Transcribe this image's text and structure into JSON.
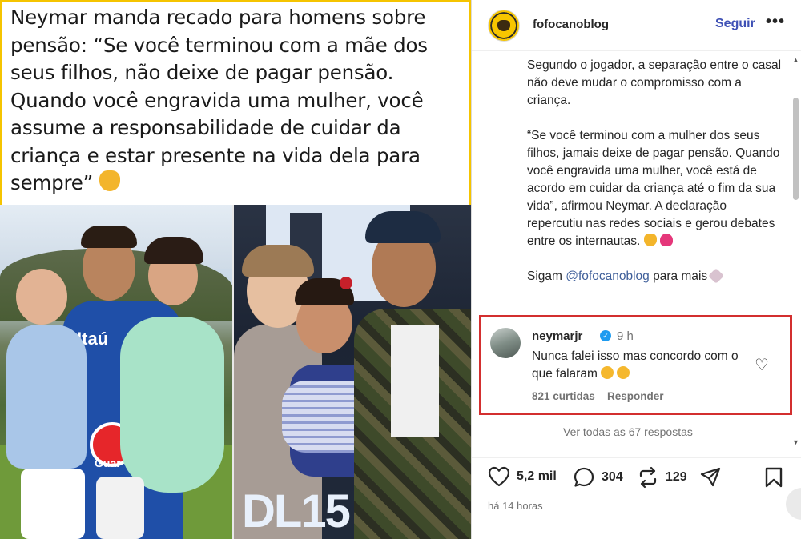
{
  "post": {
    "tweet_text": "Neymar manda recado para homens sobre\npensão: “Se você terminou com a mãe dos\nseus filhos, não deixe de pagar pensão.\nQuando você engravida uma mulher, você\nassume a responsabilidade de cuidar da\ncriança e estar presente na vida dela para\nsempre”",
    "photo_left_text": "Itaú",
    "photo_right_text": "DL15",
    "border_color": "#f5c400"
  },
  "header": {
    "username": "fofocanoblog",
    "follow_label": "Seguir",
    "more_label": "•••"
  },
  "caption": {
    "paragraph1": "Segundo o jogador, a separação entre o casal não deve mudar o compromisso com a criança.",
    "paragraph2": "“Se você terminou com a mulher dos seus filhos, jamais deixe de pagar pensão. Quando você engravida uma mulher, você está de acordo em cuidar da criança até o fim da sua vida”, afirmou Neymar. A declaração repercutiu nas redes sociais e gerou debates entre os internautas.",
    "follow_prefix": "Sigam",
    "follow_mention": "@fofocanoblog",
    "follow_suffix": "para mais"
  },
  "comment": {
    "username": "neymarjr",
    "time": "9 h",
    "text": "Nunca falei isso mas concordo com o que falaram",
    "likes": "821 curtidas",
    "reply_label": "Responder",
    "highlight_color": "#d32f2f"
  },
  "view_replies": "Ver todas as 67 respostas",
  "actions": {
    "likes": "5,2 mil",
    "comments": "304",
    "reposts": "129",
    "posted": "há 14 horas"
  },
  "icons": [
    "heart-icon",
    "comment-icon",
    "repost-icon",
    "share-icon",
    "bookmark-icon",
    "verified-icon"
  ],
  "colors": {
    "accent": "#3f51b5",
    "muted": "#737373"
  }
}
